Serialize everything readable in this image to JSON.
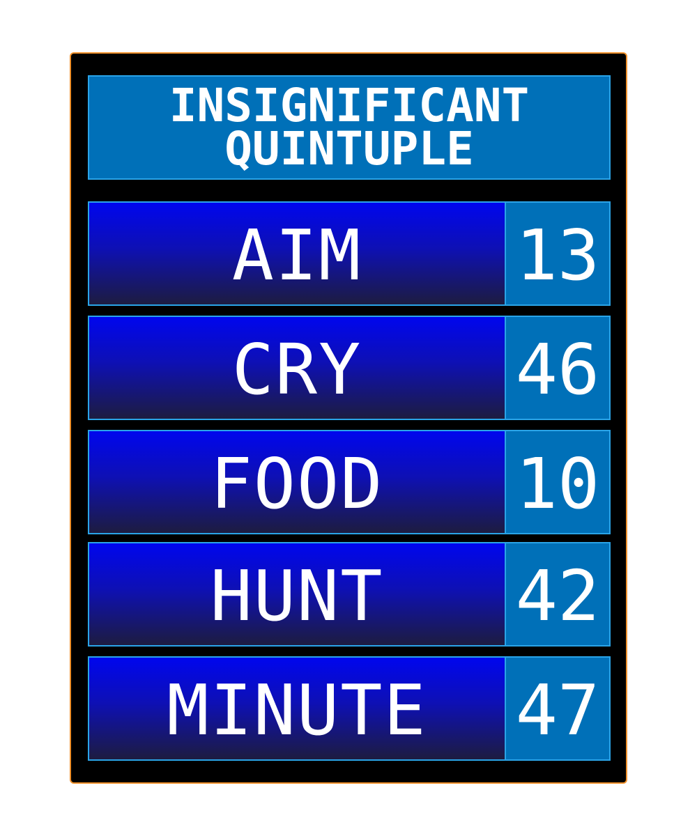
{
  "board": {
    "title": "INSIGNIFICANT\nQUINTUPLE",
    "answers": [
      {
        "text": "AIM",
        "score": "13"
      },
      {
        "text": "CRY",
        "score": "46"
      },
      {
        "text": "FOOD",
        "score": "10"
      },
      {
        "text": "HUNT",
        "score": "42"
      },
      {
        "text": "MINUTE",
        "score": "47"
      }
    ]
  },
  "colors": {
    "frame": "#000000",
    "frame_border": "#f0902a",
    "title_bg": "#0070b8",
    "answer_top": "#0006ee",
    "answer_bottom": "#1d1c40",
    "cell_border": "#2aa4e8",
    "text": "#ffffff"
  }
}
